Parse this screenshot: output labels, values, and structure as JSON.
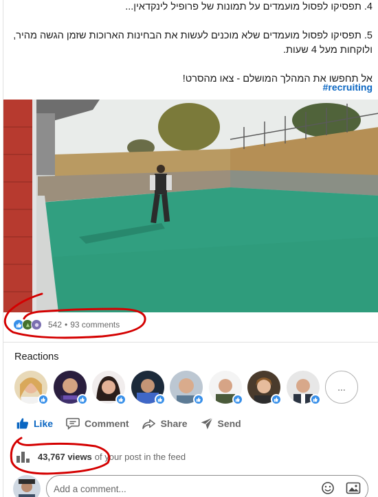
{
  "post": {
    "text_lines": [
      "4. תפסיקו לפסול מועמדים על תמונות של פרופיל לינקדאין...",
      "",
      "5. תפסיקו לפסול מועמדים שלא מוכנים לעשות את הבחינות הארוכות שזמן הגשה מהיר,",
      "ולוקחות מעל 4 שעות.",
      "",
      "אל תחפשו את המהלך המושלם - צאו מהסרט!"
    ],
    "hashtag": "#recruiting"
  },
  "social": {
    "reaction_count": "542",
    "separator": "•",
    "comments": "93 comments"
  },
  "reactions": {
    "title": "Reactions",
    "more_label": "..."
  },
  "actions": {
    "like": "Like",
    "comment": "Comment",
    "share": "Share",
    "send": "Send"
  },
  "views": {
    "count": "43,767 views",
    "suffix": "of your post in the feed"
  },
  "comment_box": {
    "placeholder": "Add a comment..."
  },
  "colors": {
    "linkedin_blue": "#0a66c2",
    "annotation_red": "#d40000"
  }
}
